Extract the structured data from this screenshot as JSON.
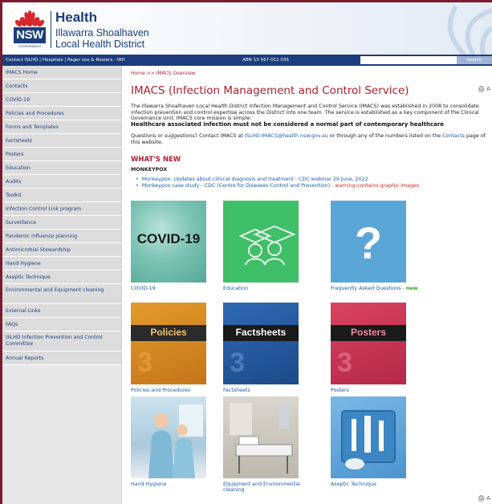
{
  "header": {
    "logo_health": "Health",
    "logo_district_line1": "Illawarra Shoalhaven",
    "logo_district_line2": "Local Health District",
    "logo_nsw": "NSW",
    "logo_gov": "GOVERNMENT"
  },
  "topbar": {
    "contact_link": "Contact ISLHD",
    "separator": "|",
    "hospitals_link": "Hospitals",
    "pager_link": "Pager nos & Rosters - WH",
    "abn": "ABN 13 567 011 035",
    "search_placeholder": "",
    "search_button": "Search"
  },
  "sidebar": {
    "items": [
      {
        "label": "IMACS Home"
      },
      {
        "label": "Contacts"
      },
      {
        "label": "COVID-19"
      },
      {
        "label": "Policies and Procedures"
      },
      {
        "label": "Forms and Templates"
      },
      {
        "label": "Factsheets"
      },
      {
        "label": "Posters"
      },
      {
        "label": "Education"
      },
      {
        "label": "Audits"
      },
      {
        "label": "Toolkit"
      },
      {
        "label": "Infection Control Link program"
      },
      {
        "label": "Surveillance"
      },
      {
        "label": "Pandemic influenza planning"
      },
      {
        "label": "Antimicrobial Stewardship"
      },
      {
        "label": "Hand Hygiene"
      },
      {
        "label": "Aseptic Technique"
      },
      {
        "label": "Environmental and Equipment cleaning"
      },
      {
        "label": "External Links"
      },
      {
        "label": "FAQs"
      },
      {
        "label": "ISLHD Infection Prevention and Control Committee"
      },
      {
        "label": "Annual Reports"
      }
    ]
  },
  "main": {
    "breadcrumb": "Home >> IMACS Overview",
    "title": "IMACS (Infection Management and Control Service)",
    "print_label": "A",
    "intro": "The Illawarra Shoalhaven Local Health District Infection Management and Control Service (IMACS) was established in 2008 to consolidate infection prevention and control expertise across the District into one team. The service is established as a key component of the Clinical Governance Unit. IMACS core mission is simple:",
    "mission": "Healthcare associated infection must not be considered a normal part of contemporary healthcare",
    "questions_pre": "Questions or suggestions?  Contact IMACS at ",
    "questions_email": "ISLHD-IMACS@health.nsw.gov.au",
    "questions_mid": " or through any of the numbers listed on the ",
    "questions_link": "Contacts",
    "questions_post": " page of this website.",
    "whats_new": "WHAT'S NEW",
    "monkeypox_heading": "MONKEYPOX",
    "monkeypox_items": [
      {
        "text": "Monkeypox:  Updates about clinical diagnosis and treatment - CDC webinar 29 June, 2022",
        "warning": ""
      },
      {
        "text": "Monkeypox case study - CDC (Centre for Diseases Control and Prevention) - ",
        "warning": "warning-contains graphic images"
      }
    ],
    "tiles": [
      {
        "caption": "COVID-19",
        "badge": "",
        "image_text": "COVID-19"
      },
      {
        "caption": "Education",
        "badge": "",
        "image_text": ""
      },
      {
        "caption": "Frequently Asked Questions - ",
        "badge": "new",
        "image_text": "?"
      },
      {
        "caption": "Policies and Procedures",
        "badge": "",
        "image_text": "Policies"
      },
      {
        "caption": "Factsheets",
        "badge": "",
        "image_text": "Factsheets"
      },
      {
        "caption": "Posters",
        "badge": "",
        "image_text": "Posters"
      },
      {
        "caption": "Hand Hygiene",
        "badge": "",
        "image_text": ""
      },
      {
        "caption": "Equipment and Environmental cleaning",
        "badge": "",
        "image_text": ""
      },
      {
        "caption": "Aseptic Technique",
        "badge": "",
        "image_text": ""
      }
    ]
  },
  "colors": {
    "brand_navy": "#1b3d7e",
    "accent_red": "#b01e2e",
    "link_blue": "#1b5aa6",
    "new_green": "#3a9a2a"
  }
}
